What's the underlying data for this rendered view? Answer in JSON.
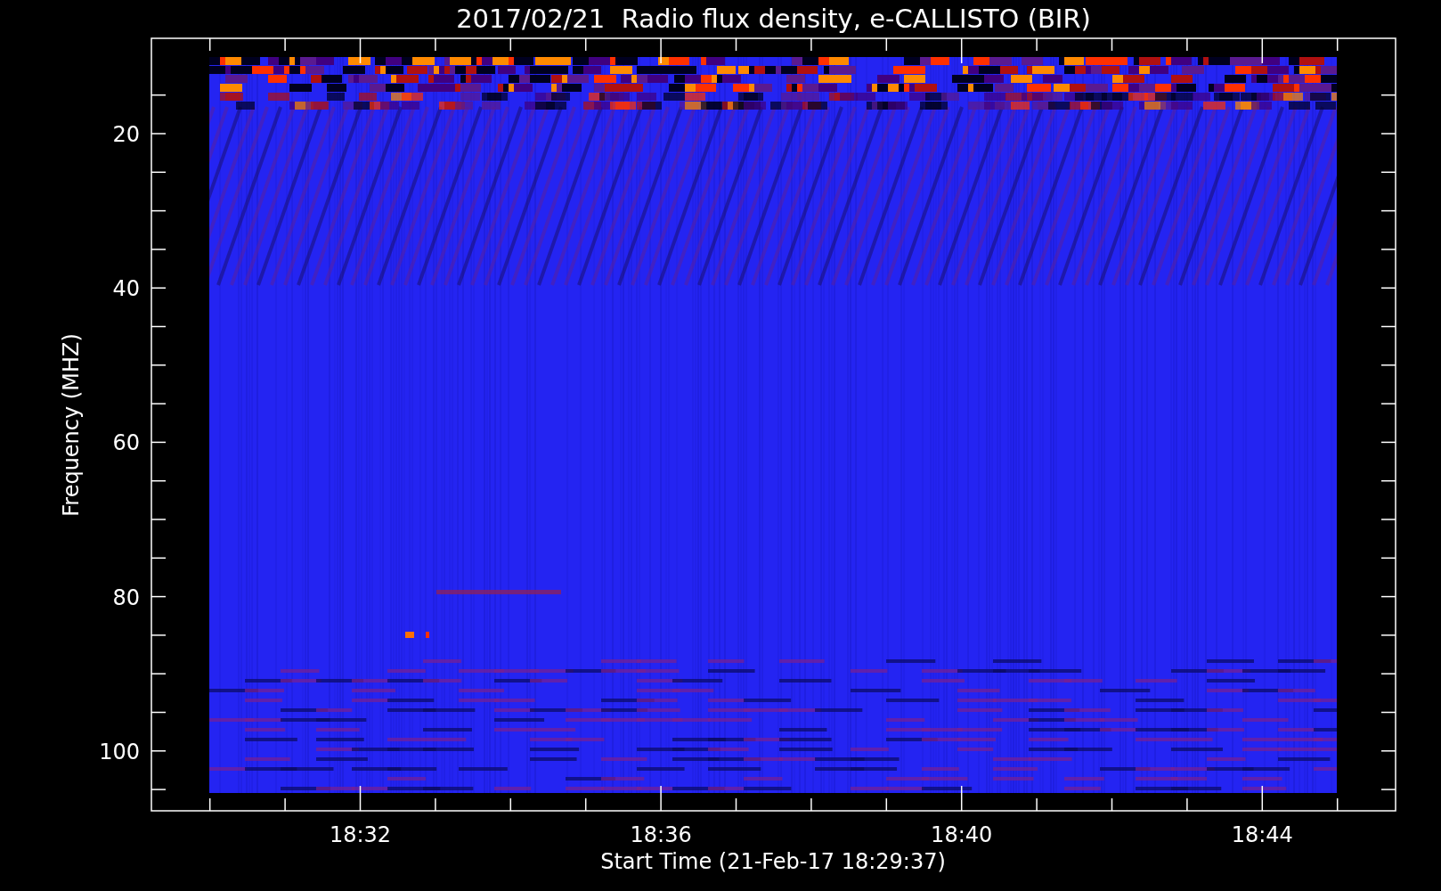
{
  "title": "2017/02/21  Radio flux density, e-CALLISTO (BIR)",
  "y_axis": {
    "label": "Frequency (MHZ)",
    "ticks": [
      "20",
      "40",
      "60",
      "80",
      "100"
    ]
  },
  "x_axis": {
    "label": "Start Time (21-Feb-17 18:29:37)",
    "ticks": [
      "18:32",
      "18:36",
      "18:40",
      "18:44"
    ]
  }
}
